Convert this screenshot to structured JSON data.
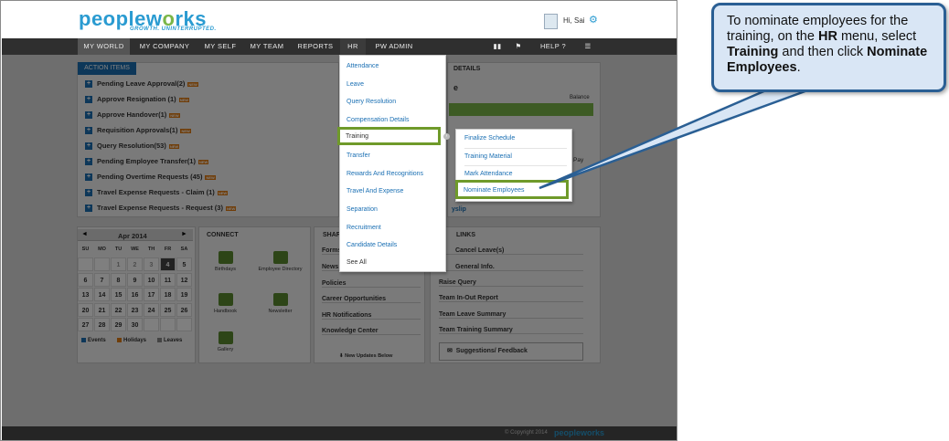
{
  "header": {
    "logo_text_a": "peoplew",
    "logo_text_b": "rks",
    "tagline": "GROWTH. UNINTERRUPTED.",
    "user_greeting": "Hi, Sai"
  },
  "nav": {
    "items": [
      "MY WORLD",
      "MY COMPANY",
      "MY SELF",
      "MY TEAM",
      "REPORTS",
      "HR",
      "PW ADMIN"
    ],
    "help_label": "HELP"
  },
  "action_items": {
    "tab_label": "ACTION ITEMS",
    "items": [
      "Pending Leave Approval(2)",
      "Approve Resignation (1)",
      "Approve Handover(1)",
      "Requisition Approvals(1)",
      "Query Resolution(53)",
      "Pending Employee Transfer(1)",
      "Pending Overtime Requests (45)",
      "Travel Expense Requests - Claim (1)",
      "Travel Expense Requests - Request (3)"
    ],
    "new_badge": "NEW"
  },
  "right_panel": {
    "title_fragment": "DETAILS",
    "letter": "e",
    "balance_label": "Balance",
    "pay_fragment": "Pay",
    "payslip_fragment": "yslip"
  },
  "calendar": {
    "month_label": "Apr 2014",
    "days_of_week": [
      "SU",
      "MO",
      "TU",
      "WE",
      "TH",
      "FR",
      "SA"
    ],
    "weeks": [
      [
        "",
        "",
        "1",
        "2",
        "3",
        "4",
        "5"
      ],
      [
        "6",
        "7",
        "8",
        "9",
        "10",
        "11",
        "12"
      ],
      [
        "13",
        "14",
        "15",
        "16",
        "17",
        "18",
        "19"
      ],
      [
        "20",
        "21",
        "22",
        "23",
        "24",
        "25",
        "26"
      ],
      [
        "27",
        "28",
        "29",
        "30",
        "",
        "",
        ""
      ]
    ],
    "legend": [
      {
        "label": "Events",
        "color": "#1a6fb3"
      },
      {
        "label": "Holidays",
        "color": "#e07a10"
      },
      {
        "label": "Leaves",
        "color": "#888888"
      }
    ]
  },
  "connect": {
    "title": "CONNECT",
    "tiles": [
      "Birthdays",
      "Employee Directory",
      "Handbook",
      "Newsletter",
      "Gallery"
    ]
  },
  "share": {
    "title_fragment": "SHAR",
    "items": [
      "Forms",
      "News",
      "Policies",
      "Career Opportunities",
      "HR Notifications",
      "Knowledge Center"
    ],
    "footer": "New Updates Below"
  },
  "quick_links": {
    "title_fragment": "LINKS",
    "items": [
      "Cancel Leave(s)",
      "General Info.",
      "Raise Query",
      "Team In-Out Report",
      "Team Leave Summary",
      "Team Training Summary"
    ],
    "feedback": "Suggestions/ Feedback"
  },
  "hr_menu": {
    "items": [
      "Attendance",
      "Leave",
      "Query Resolution",
      "Compensation Details",
      "Training",
      "Transfer",
      "Rewards And Recognitions",
      "Travel And Expense",
      "Separation",
      "Recruitment",
      "Candidate Details",
      "See All"
    ]
  },
  "training_submenu": {
    "items": [
      "Finalize Schedule",
      "Training Material",
      "Mark Attendance",
      "Nominate Employees"
    ]
  },
  "footer": {
    "copyright": "© Copyright 2014",
    "logo": "peopleworks"
  },
  "callout": {
    "part1": "To nominate employees for the training, on the ",
    "bold1": "HR",
    "part2": " menu, select ",
    "bold2": "Training",
    "part3": " and then click ",
    "bold3": "Nominate Employees",
    "part4": "."
  },
  "colors": {
    "brand_blue": "#2a9bd1",
    "brand_green": "#7ab648",
    "highlight_green": "#6f9a2a",
    "callout_border": "#2a5f94",
    "callout_fill": "#d9e6f5"
  }
}
